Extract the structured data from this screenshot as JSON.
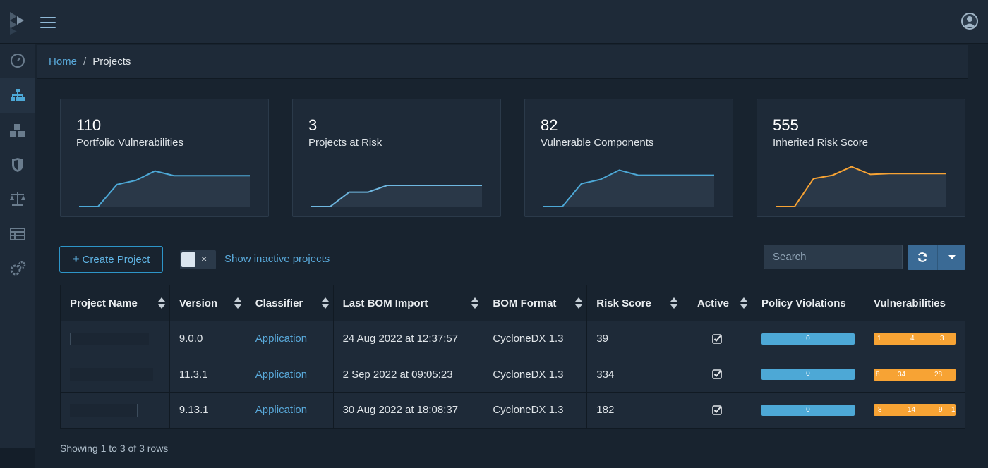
{
  "breadcrumb": {
    "home": "Home",
    "separator": "/",
    "current": "Projects"
  },
  "widgets": [
    {
      "value": "110",
      "label": "Portfolio Vulnerabilities",
      "color": "#4da8d6",
      "trend": [
        0,
        0,
        0.52,
        0.62,
        0.84,
        0.73,
        0.73,
        0.73,
        0.73,
        0.73
      ]
    },
    {
      "value": "3",
      "label": "Projects at Risk",
      "color": "#6fb7e0",
      "trend": [
        0,
        0,
        0.34,
        0.34,
        0.5,
        0.5,
        0.5,
        0.5,
        0.5,
        0.5
      ]
    },
    {
      "value": "82",
      "label": "Vulnerable Components",
      "color": "#4da8d6",
      "trend": [
        0,
        0,
        0.54,
        0.64,
        0.86,
        0.74,
        0.74,
        0.74,
        0.74,
        0.74
      ]
    },
    {
      "value": "555",
      "label": "Inherited Risk Score",
      "color": "#f7a334",
      "trend": [
        0,
        0,
        0.66,
        0.74,
        0.94,
        0.76,
        0.78,
        0.78,
        0.78,
        0.78
      ]
    }
  ],
  "toolbar": {
    "create_label": "Create Project",
    "toggle_x": "×",
    "inactive_label": "Show inactive projects",
    "search_placeholder": "Search"
  },
  "table": {
    "headers": [
      "Project Name",
      "Version",
      "Classifier",
      "Last BOM Import",
      "BOM Format",
      "Risk Score",
      "Active",
      "Policy Violations",
      "Vulnerabilities"
    ],
    "rows": [
      {
        "version": "9.0.0",
        "classifier": "Application",
        "last_import": "24 Aug 2022 at 12:37:57",
        "format": "CycloneDX 1.3",
        "risk": "39",
        "policy": "0",
        "vulns": [
          "1",
          "4",
          "3"
        ]
      },
      {
        "version": "11.3.1",
        "classifier": "Application",
        "last_import": "2 Sep 2022 at 09:05:23",
        "format": "CycloneDX 1.3",
        "risk": "334",
        "policy": "0",
        "vulns": [
          "8",
          "34",
          "28"
        ]
      },
      {
        "version": "9.13.1",
        "classifier": "Application",
        "last_import": "30 Aug 2022 at 18:08:37",
        "format": "CycloneDX 1.3",
        "risk": "182",
        "policy": "0",
        "vulns": [
          "8",
          "14",
          "9",
          "1"
        ]
      }
    ]
  },
  "footer": {
    "showing": "Showing 1 to 3 of 3 rows"
  },
  "colors": {
    "accent": "#59a9da",
    "critical": "#f7a334",
    "policy": "#4da8d6"
  }
}
